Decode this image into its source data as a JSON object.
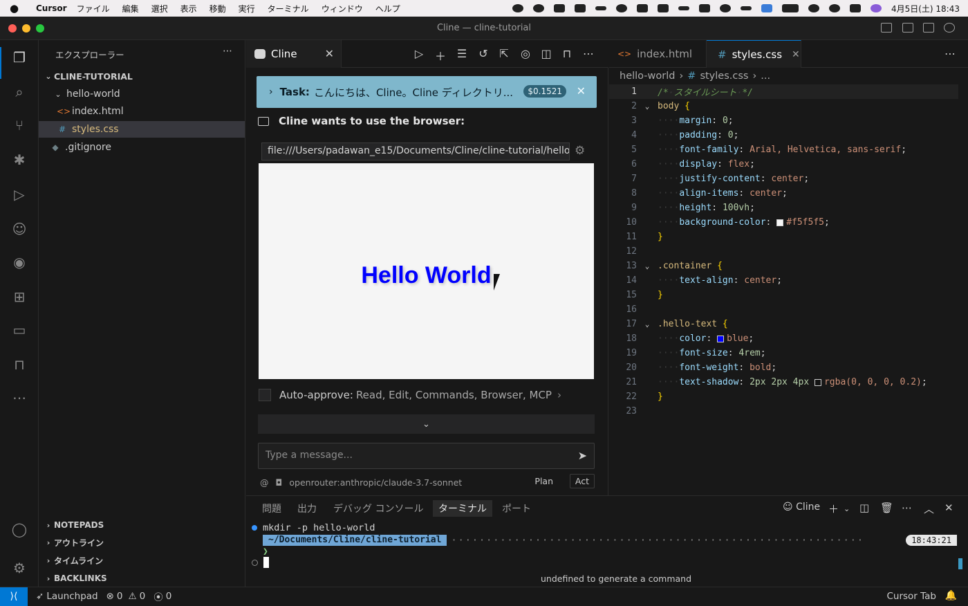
{
  "menubar": {
    "app_name": "Cursor",
    "items": [
      "ファイル",
      "編集",
      "選択",
      "表示",
      "移動",
      "実行",
      "ターミナル",
      "ウィンドウ",
      "ヘルプ"
    ],
    "clock": "4月5日(土)  18:43"
  },
  "window": {
    "title": "Cline — cline-tutorial"
  },
  "explorer": {
    "title": "エクスプローラー",
    "root": "CLINE-TUTORIAL",
    "folder": "hello-world",
    "files": [
      "index.html",
      "styles.css"
    ],
    "root_files": [
      ".gitignore"
    ],
    "sections": [
      "NOTEPADS",
      "アウトライン",
      "タイムライン",
      "BACKLINKS"
    ]
  },
  "cline": {
    "tab_label": "Cline",
    "task_label": "Task:",
    "task_text": "こんにちは、Cline。Cline ディレクトリ...",
    "task_cost": "$0.1521",
    "browser_heading": "Cline wants to use the browser:",
    "url": "file:///Users/padawan_e15/Documents/Cline/cline-tutorial/hello-...",
    "page_text": "Hello World",
    "autoapprove_label": "Auto-approve:",
    "autoapprove_values": "Read, Edit, Commands, Browser, MCP",
    "message_placeholder": "Type a message...",
    "model": "openrouter:anthropic/claude-3.7-sonnet",
    "plan_label": "Plan",
    "act_label": "Act"
  },
  "editor": {
    "tabs": [
      "index.html",
      "styles.css"
    ],
    "active_tab": "styles.css",
    "breadcrumb": [
      "hello-world",
      "styles.css",
      "..."
    ],
    "code": [
      "/* スタイルシート */",
      "body {",
      "    margin: 0;",
      "    padding: 0;",
      "    font-family: Arial, Helvetica, sans-serif;",
      "    display: flex;",
      "    justify-content: center;",
      "    align-items: center;",
      "    height: 100vh;",
      "    background-color: #f5f5f5;",
      "}",
      "",
      ".container {",
      "    text-align: center;",
      "}",
      "",
      ".hello-text {",
      "    color: blue;",
      "    font-size: 4rem;",
      "    font-weight: bold;",
      "    text-shadow: 2px 2px 4px rgba(0, 0, 0, 0.2);",
      "}",
      ""
    ]
  },
  "panel": {
    "tabs": [
      "問題",
      "出力",
      "デバッグ コンソール",
      "ターミナル",
      "ポート"
    ],
    "active_tab": "ターミナル",
    "terminal_name": "Cline",
    "command": "mkdir -p hello-world",
    "path_prefix": "~/Documents/Cline/",
    "path_bold": "cline-tutorial",
    "time": "18:43:21",
    "prompt": "❯",
    "hint": "undefined to generate a command"
  },
  "statusbar": {
    "launchpad": "Launchpad",
    "errors": "0",
    "warnings": "0",
    "ports": "0",
    "right": "Cursor Tab"
  },
  "colors": {
    "accent": "#0078d4",
    "task_banner": "#7fb7cc",
    "hello_text": "#0000ff"
  }
}
